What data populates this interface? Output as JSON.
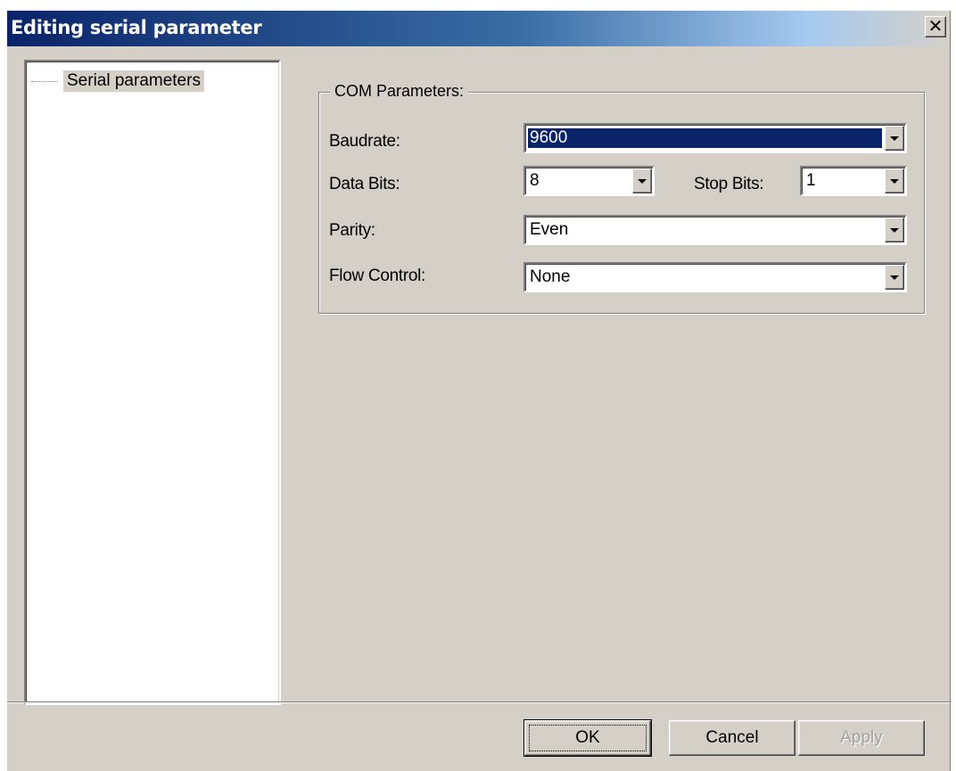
{
  "window": {
    "title": "Editing serial parameter",
    "close_glyph": "✕"
  },
  "tree": {
    "items": [
      {
        "label": "Serial parameters",
        "selected": true
      }
    ]
  },
  "com_parameters": {
    "group_title": "COM Parameters:",
    "baudrate": {
      "label": "Baudrate:",
      "value": "9600"
    },
    "data_bits": {
      "label": "Data Bits:",
      "value": "8"
    },
    "stop_bits": {
      "label": "Stop Bits:",
      "value": "1"
    },
    "parity": {
      "label": "Parity:",
      "value": "Even"
    },
    "flow_control": {
      "label": "Flow Control:",
      "value": "None"
    }
  },
  "buttons": {
    "ok": "OK",
    "cancel": "Cancel",
    "apply": "Apply"
  },
  "colors": {
    "dialog_bg": "#d4d0c8",
    "title_bar": "#0a246a",
    "selection": "#0a246a"
  }
}
